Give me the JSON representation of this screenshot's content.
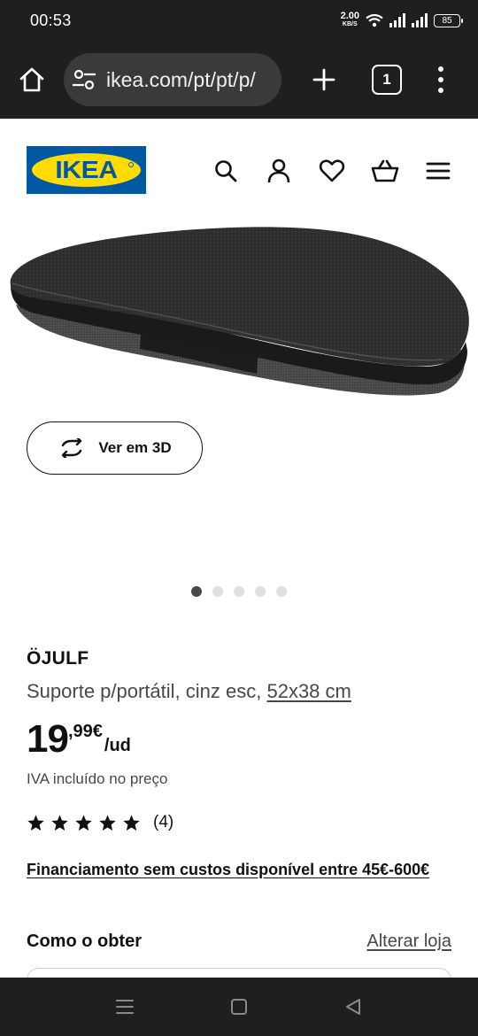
{
  "status_bar": {
    "time": "00:53",
    "net_speed_value": "2.00",
    "net_speed_unit": "KB/S",
    "battery": "85"
  },
  "browser": {
    "url": "ikea.com/pt/pt/p/",
    "tab_count": "1"
  },
  "header": {
    "logo_text": "IKEA",
    "icons": [
      "search-icon",
      "account-icon",
      "heart-icon",
      "cart-icon",
      "hamburger-menu-icon"
    ]
  },
  "gallery": {
    "view3d_label": "Ver em 3D",
    "dot_count": 5,
    "active_dot": 0
  },
  "product": {
    "name": "ÖJULF",
    "description": "Suporte p/portátil, cinz esc, ",
    "size": "52x38 cm",
    "price_integer": "19",
    "price_decimal": ",99€",
    "price_unit": "/ud",
    "vat_note": "IVA incluído no preço",
    "rating_stars": 5,
    "review_count": "(4)",
    "financing": "Financiamento sem custos disponível entre 45€-600€"
  },
  "availability": {
    "title": "Como o obter",
    "change_store": "Alterar loja"
  },
  "colors": {
    "ikea_blue": "#0058a3",
    "ikea_yellow": "#ffdb00",
    "browser_chrome": "#1f1f1f",
    "text_secondary": "#484848"
  }
}
